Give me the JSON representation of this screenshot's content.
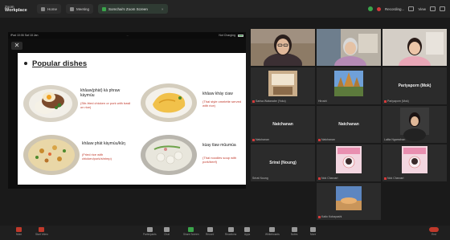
{
  "topbar": {
    "brand_small": "Zoom",
    "brand_big": "Workplace",
    "tabs": [
      {
        "label": "Home",
        "active": false
      },
      {
        "label": "Meeting",
        "active": false
      },
      {
        "label": "Somchai's Zoom Screen",
        "active": true
      }
    ],
    "status_recording": "Recording...",
    "view_label": "View"
  },
  "shared_screen": {
    "status_left": "iPad  10:06  Sat 18 Jan",
    "status_mid": "...",
    "status_right": "Not Charging",
    "close_symbol": "✕",
    "slide": {
      "title": "Popular dishes",
      "dishes": [
        {
          "name": "khâaw(phàt) kà phraw kàymùu",
          "desc": "(Stir-fried chicken or pork with basil on rice)"
        },
        {
          "name": "khâaw khày ciaw",
          "desc": "(Thai style omelette served with rice)"
        },
        {
          "name": "khâaw phàt kàymùu/kûŋ",
          "desc": "(Fried rice with chicken/pork/shrimp)"
        },
        {
          "name": "kùay tǐaw mǔumùa",
          "desc": "(Thai noodles soup with pork/beef)"
        }
      ]
    }
  },
  "gallery": {
    "tiles": [
      {
        "name": "",
        "label": "",
        "kind": "video-woman-glasses"
      },
      {
        "name": "",
        "label": "",
        "kind": "video-older-woman"
      },
      {
        "name": "",
        "label": "",
        "kind": "video-woman-pink"
      },
      {
        "name": "Sarisa Watanabe (Yoko)",
        "label": "",
        "kind": "photo-room"
      },
      {
        "name": "Hiroshi",
        "label": "",
        "kind": "photo-temple"
      },
      {
        "name": "Pariyaporn (Mok)",
        "label": "Pariyaporn (Mok)",
        "kind": "name"
      },
      {
        "name": "Natchanan",
        "label": "Natchanan",
        "kind": "name"
      },
      {
        "name": "Natchanan",
        "label": "Natchanan",
        "kind": "name"
      },
      {
        "name": "Lalita Ngamchan",
        "label": "",
        "kind": "video-woman-dark"
      },
      {
        "name": "Srirat Noung",
        "label": "Srirat (Noung)",
        "kind": "name"
      },
      {
        "name": "Nok Charusri",
        "label": "",
        "kind": "avatar-card"
      },
      {
        "name": "Nok Charusri",
        "label": "",
        "kind": "avatar-card"
      },
      {
        "name": "Kaito Kobayashi",
        "label": "",
        "kind": "photo-sky"
      }
    ]
  },
  "toolbar": {
    "items": [
      "Mute",
      "Start Video",
      "Participants",
      "Chat",
      "Share Screen",
      "Record",
      "Reactions",
      "Apps",
      "Whiteboards",
      "Notes",
      "More",
      "End"
    ]
  },
  "colors": {
    "accent_green": "#3aa44a",
    "record_red": "#d23b3b",
    "slide_desc_red": "#c0392b"
  }
}
